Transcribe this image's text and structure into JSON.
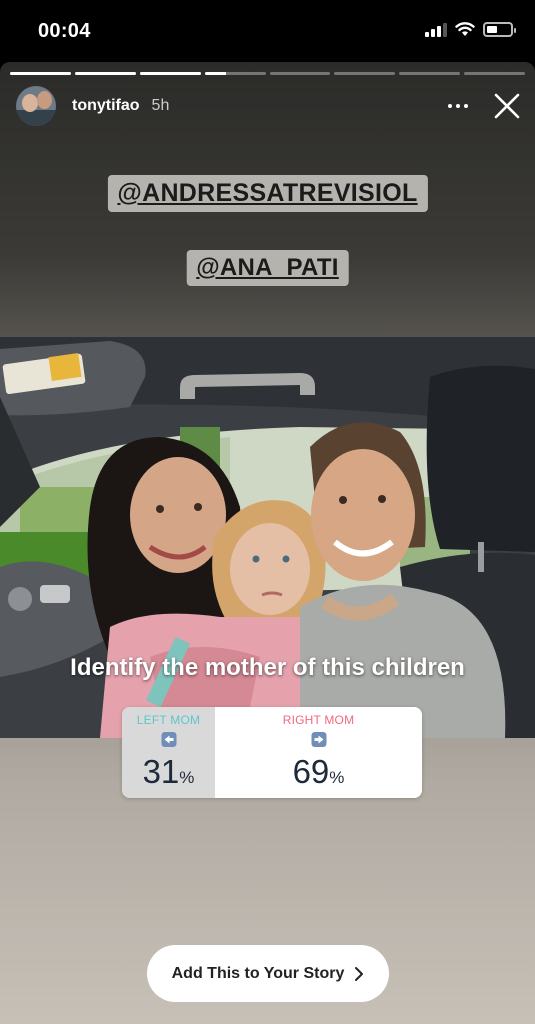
{
  "status_bar": {
    "time": "00:04"
  },
  "story": {
    "username": "tonytifao",
    "time_ago": "5h",
    "segments_total": 8,
    "segments_complete": 3,
    "current_segment_progress": 0.35,
    "mentions": [
      "@ANDRESSATREVISIOL",
      "@ANA_PATI"
    ],
    "caption": "Identify the mother of this children",
    "add_button": "Add This to Your Story"
  },
  "poll": {
    "options": [
      {
        "label": "LEFT MOM",
        "percent": "31",
        "unit": "%",
        "label_color": "#5fc6c9",
        "arrow": "left-arrow-emoji-icon"
      },
      {
        "label": "RIGHT MOM",
        "percent": "69",
        "unit": "%",
        "label_color": "#f06a7e",
        "arrow": "right-arrow-emoji-icon"
      }
    ]
  },
  "icons": [
    "cellular-signal-icon",
    "wifi-icon",
    "battery-icon",
    "more-options-icon",
    "close-icon",
    "chevron-right-icon"
  ]
}
